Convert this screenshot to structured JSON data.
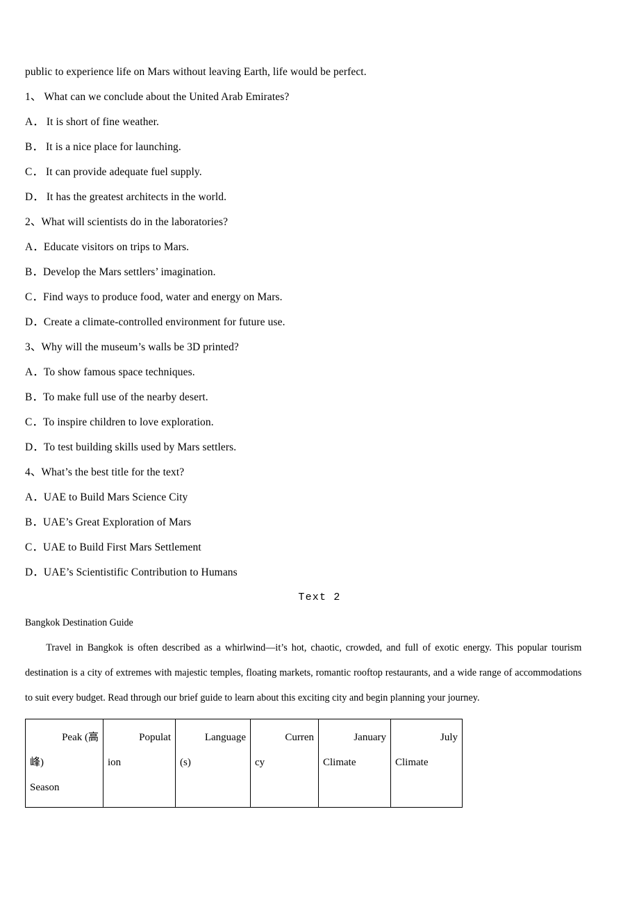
{
  "document": {
    "continuation_line": "public to experience life on Mars without leaving Earth, life would be perfect."
  },
  "questions": [
    {
      "number": "1、",
      "prompt": "What can we conclude about the United Arab Emirates?",
      "options": [
        {
          "letter": "A．",
          "text": "It is short of fine weather."
        },
        {
          "letter": "B．",
          "text": "It is a nice place for launching."
        },
        {
          "letter": "C．",
          "text": "It can provide adequate fuel supply."
        },
        {
          "letter": "D．",
          "text": "It has the greatest architects in the world."
        }
      ]
    },
    {
      "number": "2、",
      "prompt": "What will scientists do in the laboratories?",
      "options": [
        {
          "letter": "A．",
          "text": "Educate visitors on trips to Mars."
        },
        {
          "letter": "B．",
          "text": "Develop the Mars settlers’ imagination."
        },
        {
          "letter": "C．",
          "text": "Find ways to produce food, water and energy on Mars."
        },
        {
          "letter": "D．",
          "text": "Create a climate-controlled environment for future use."
        }
      ]
    },
    {
      "number": "3、",
      "prompt": "Why will the museum’s walls be 3D printed?",
      "options": [
        {
          "letter": "A．",
          "text": "To show famous space techniques."
        },
        {
          "letter": "B．",
          "text": "To make full use of the nearby desert."
        },
        {
          "letter": "C．",
          "text": "To inspire children to love exploration."
        },
        {
          "letter": "D．",
          "text": "To test building skills used by Mars settlers."
        }
      ]
    },
    {
      "number": "4、",
      "prompt": "What’s the best title for the text?",
      "options": [
        {
          "letter": "A．",
          "text": "UAE to Build Mars Science City"
        },
        {
          "letter": "B．",
          "text": "UAE’s Great Exploration of Mars"
        },
        {
          "letter": "C．",
          "text": "UAE to Build First Mars Settlement"
        },
        {
          "letter": "D．",
          "text": "UAE’s Scientistific Contribution to Humans"
        }
      ]
    }
  ],
  "text2": {
    "heading": "Text 2",
    "subtitle": "Bangkok Destination Guide",
    "paragraph": "Travel in Bangkok is often described as a whirlwind—it’s hot, chaotic, crowded, and full of exotic energy. This popular tourism destination is a city of extremes with majestic temples, floating markets, romantic rooftop restaurants, and a wide range of accommodations to suit every budget. Read through our brief guide to learn about this exciting city and begin planning your journey."
  },
  "guide_table": {
    "header_cells": [
      {
        "line1": "Peak (高",
        "line2": "峰)",
        "line3": "Season"
      },
      {
        "line1": "Populat",
        "line2": "ion",
        "line3": ""
      },
      {
        "line1": "Language",
        "line2": "(s)",
        "line3": ""
      },
      {
        "line1": "Curren",
        "line2": "cy",
        "line3": ""
      },
      {
        "line1": "January",
        "line2": "Climate",
        "line3": ""
      },
      {
        "line1": "July",
        "line2": "Climate",
        "line3": ""
      }
    ]
  }
}
